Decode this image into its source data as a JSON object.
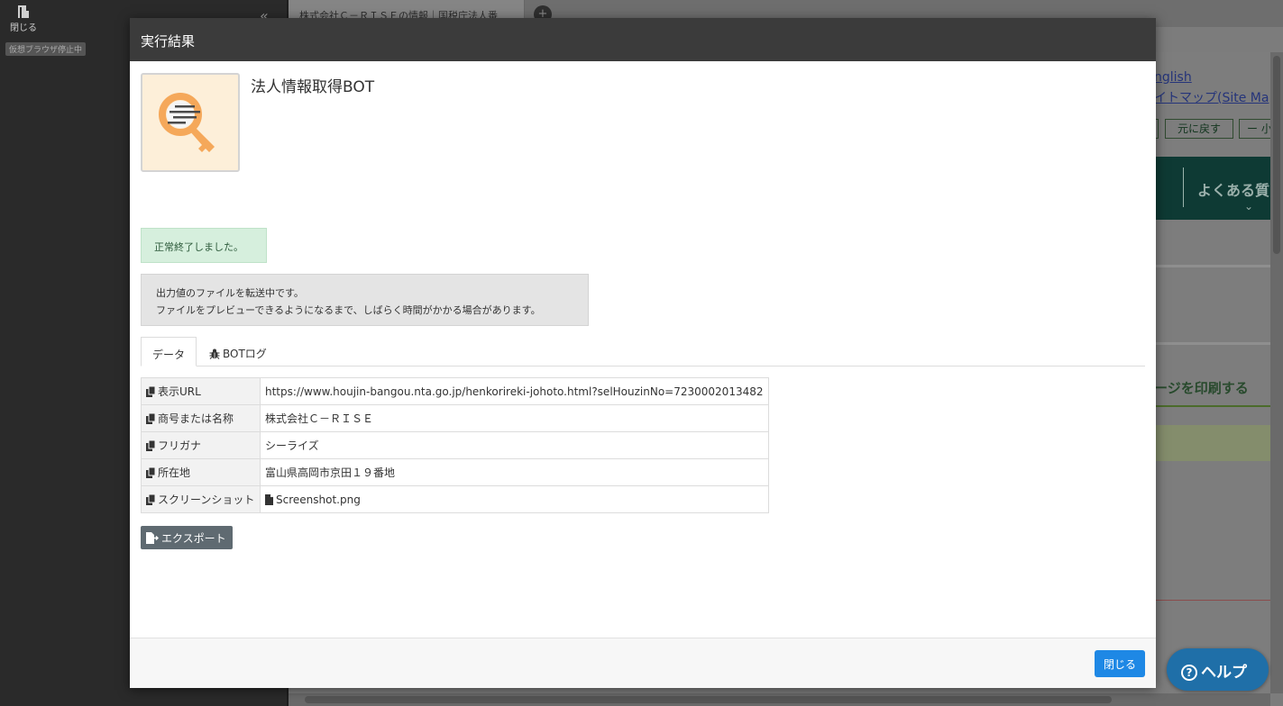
{
  "sidebar": {
    "close_label": "閉じる",
    "status_badge": "仮想ブラウザ停止中"
  },
  "background_browser": {
    "tab_title": "株式会社Ｃ－ＲＩＳＥの情報｜国税庁法人番",
    "english_link": "nglish",
    "sitemap_link": "イトマップ(Site Ma",
    "restore_button": "元に戻す",
    "small_button": "ー 小",
    "faq_label": "よくある質",
    "print_label": "ージを印刷する"
  },
  "modal": {
    "title": "実行結果",
    "bot_name": "法人情報取得BOT",
    "success_message": "正常終了しました。",
    "info_lines": [
      "出力値のファイルを転送中です。",
      "ファイルをプレビューできるようになるまで、しばらく時間がかかる場合があります。"
    ],
    "tabs": [
      {
        "label": "データ",
        "active": true
      },
      {
        "label": "BOTログ",
        "active": false
      }
    ],
    "rows": [
      {
        "key": "表示URL",
        "value": "https://www.houjin-bangou.nta.go.jp/henkorireki-johoto.html?selHouzinNo=7230002013482"
      },
      {
        "key": "商号または名称",
        "value": "株式会社Ｃ－ＲＩＳＥ"
      },
      {
        "key": "フリガナ",
        "value": "シーライズ"
      },
      {
        "key": "所在地",
        "value": "富山県高岡市京田１９番地"
      },
      {
        "key": "スクリーンショット",
        "value": "Screenshot.png"
      }
    ],
    "export_label": "エクスポート",
    "close_label": "閉じる"
  },
  "help": {
    "label": "ヘルプ"
  },
  "colors": {
    "header_bg": "#3b3b3b",
    "primary_button": "#1e88e5",
    "success_bg": "#d6efdd",
    "help_bubble": "#1f6fa8"
  },
  "icons": [
    "door-icon",
    "double-chevron-left-icon",
    "plus-circle-icon",
    "key-search-icon",
    "bug-icon",
    "copy-icon",
    "file-icon",
    "export-icon",
    "question-circle-icon"
  ]
}
